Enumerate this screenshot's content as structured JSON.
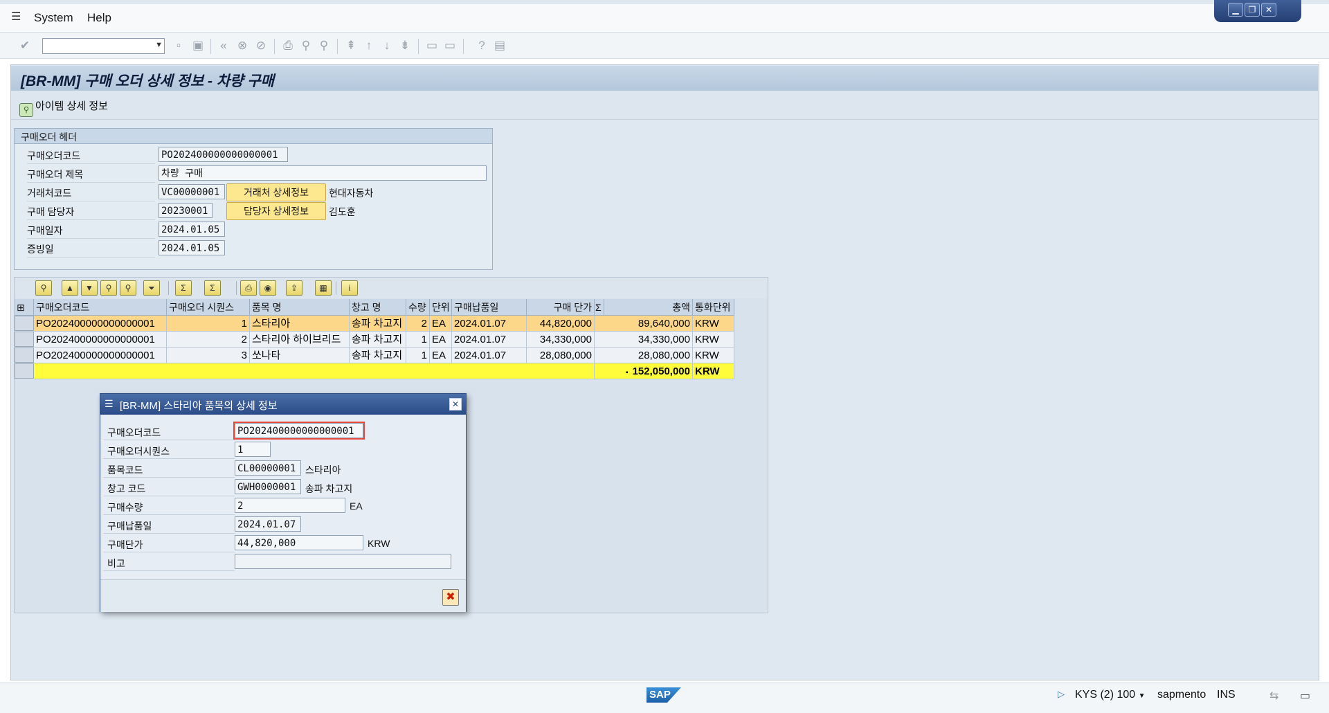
{
  "menu": {
    "system": "System",
    "help": "Help"
  },
  "window_controls": {
    "minimize": "▁",
    "restore": "❐",
    "close": "✕"
  },
  "page_title": "[BR-MM] 구매 오더 상세 정보 - 차량 구매",
  "app_toolbar": {
    "item_detail_label": "아이템 상세 정보"
  },
  "header_group": {
    "title": "구매오더 헤더",
    "po_code_label": "구매오더코드",
    "po_code": "PO202400000000000001",
    "po_title_label": "구매오더 제목",
    "po_title": "차량 구매",
    "vendor_code_label": "거래처코드",
    "vendor_code": "VC00000001",
    "vendor_detail_button": "거래처 상세정보",
    "vendor_name": "현대자동차",
    "buyer_label": "구매 담당자",
    "buyer_id": "20230001",
    "buyer_detail_button": "담당자 상세정보",
    "buyer_name": "김도훈",
    "purchase_date_label": "구매일자",
    "purchase_date": "2024.01.05",
    "evidence_date_label": "증빙일",
    "evidence_date": "2024.01.05"
  },
  "grid": {
    "columns": [
      "구매오더코드",
      "구매오더 시퀀스",
      "품목 명",
      "창고 명",
      "수량",
      "단위",
      "구매납품일",
      "구매 단가",
      "총액",
      "통화단위"
    ],
    "sum_marker": "Σ",
    "rows": [
      [
        "PO202400000000000001",
        "1",
        "스타리아",
        "송파 차고지",
        "2",
        "EA",
        "2024.01.07",
        "44,820,000",
        "89,640,000",
        "KRW"
      ],
      [
        "PO202400000000000001",
        "2",
        "스타리아 하이브리드",
        "송파 차고지",
        "1",
        "EA",
        "2024.01.07",
        "34,330,000",
        "34,330,000",
        "KRW"
      ],
      [
        "PO202400000000000001",
        "3",
        "쏘나타",
        "송파 차고지",
        "1",
        "EA",
        "2024.01.07",
        "28,080,000",
        "28,080,000",
        "KRW"
      ]
    ],
    "total": {
      "marker": "▪",
      "amount": "152,050,000",
      "currency": "KRW"
    }
  },
  "dialog": {
    "title": "[BR-MM] 스타리아 품목의 상세 정보",
    "po_code_label": "구매오더코드",
    "po_code": "PO202400000000000001",
    "seq_label": "구매오더시퀀스",
    "seq": "1",
    "item_code_label": "품목코드",
    "item_code": "CL00000001",
    "item_name": "스타리아",
    "wh_code_label": "창고 코드",
    "wh_code": "GWH0000001",
    "wh_name": "송파 차고지",
    "qty_label": "구매수량",
    "qty": "2",
    "unit": "EA",
    "delivery_label": "구매납품일",
    "delivery": "2024.01.07",
    "price_label": "구매단가",
    "price": "44,820,000",
    "currency": "KRW",
    "note_label": "비고",
    "note": ""
  },
  "status": {
    "system": "KYS (2) 100",
    "server": "sapmento",
    "mode": "INS",
    "logo": "SAP"
  }
}
